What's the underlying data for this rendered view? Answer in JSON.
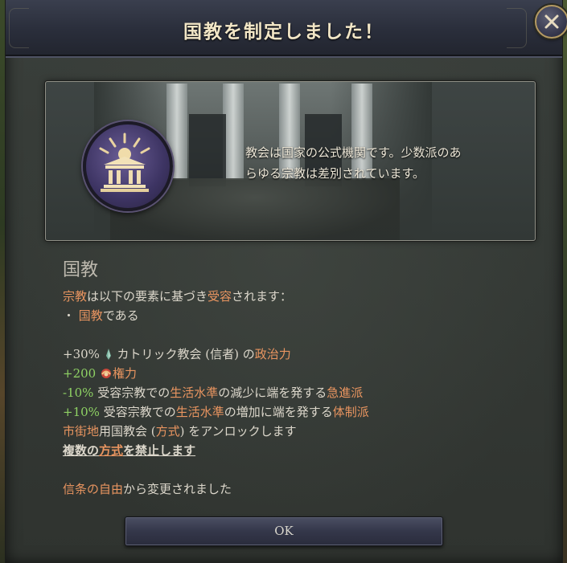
{
  "dialog": {
    "title": "国教を制定しました！",
    "close_icon": "close-icon"
  },
  "illustration": {
    "emblem_icon": "state-religion-temple-icon",
    "description_line1": "教会は国家の公式機関です。少数派のあ",
    "description_line2": "らゆる宗教は差別されています。"
  },
  "law": {
    "name": "国教",
    "accept_line": {
      "term1": "宗教",
      "text1": "は以下の要素に基づき",
      "term2": "受容",
      "text2": "されます："
    },
    "criteria_bullet": "・",
    "criteria_term": "国教",
    "criteria_text": "である"
  },
  "effects": [
    {
      "value": "+30%",
      "icon": "clout-icon",
      "text_before": " カトリック教会 (信者) の",
      "term": "政治力",
      "text_after": ""
    },
    {
      "value": "+200",
      "icon": "authority-icon",
      "term": "権力"
    },
    {
      "value": "-10%",
      "text1": " 受容宗教での",
      "term1": "生活水準",
      "text2": "の減少に端を発する",
      "term2": "急進派"
    },
    {
      "value": "+10%",
      "text1": " 受容宗教での",
      "term1": "生活水準",
      "text2": "の増加に端を発する",
      "term2": "体制派"
    }
  ],
  "unlock": {
    "term1": "市街地",
    "text1": "用国教会 (",
    "term2": "方式",
    "text2": ") をアンロックします"
  },
  "multiple": {
    "text1": "複数の",
    "term": "方式",
    "text2": "を",
    "term2": "禁止",
    "text3": "します"
  },
  "changed": {
    "term": "信条の自由",
    "text": "から変更されました"
  },
  "footer": {
    "ok_label": "OK"
  },
  "colors": {
    "highlight": "#e99560",
    "positive": "#8fd264",
    "title": "#f2e6c6"
  }
}
